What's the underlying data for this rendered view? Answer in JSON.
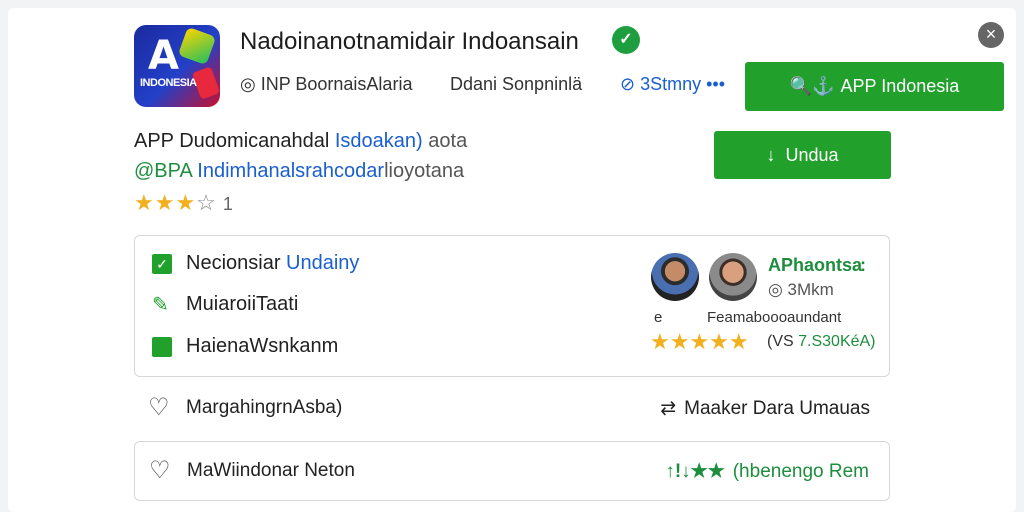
{
  "header": {
    "title": "Nadoinanotnamidair Indoansain",
    "close_icon": "×",
    "verified_icon": "✓",
    "app_icon": {
      "big": "A",
      "word": "INDONESIA"
    }
  },
  "meta": {
    "developer": "◎ INP BoornaisAlaria",
    "category": "Ddani Sonpninlä",
    "rank": "⊘ 3Stmny •••"
  },
  "buttons": {
    "primary_label": "APP Indonesia",
    "primary_icon": "🔍⚓",
    "secondary_label": "Undua",
    "secondary_icon": "↓"
  },
  "subtitle": {
    "line1_prefix": "APP Dudomicanahdal",
    "line1_link": "Isdoakan)",
    "line1_suffix": "aota",
    "line2_pub": "@BPA",
    "line2_link": "Indimhanalsrahcodar",
    "line2_suffix": "lioyotana"
  },
  "rating": {
    "full": "★",
    "half": "★",
    "empty": "☆",
    "stars_full": "★★★",
    "stars_empty": "☆",
    "count": "1"
  },
  "features": [
    {
      "icon": "check",
      "label": "Necionsiar",
      "link": "Undainy"
    },
    {
      "icon": "pencil",
      "label": "MuiaroiiTaati"
    },
    {
      "icon": "square",
      "label": "HaienaWsnkanm"
    }
  ],
  "review": {
    "name": "APhaontsa",
    "dots": ":",
    "sub": "◎ 3Mkm",
    "small_a": "e",
    "small_b": "Feamaboooaundant",
    "stars": "★★★★★",
    "score_a": "(VS",
    "score_b": "7.S30KéA)"
  },
  "rows": [
    {
      "icon": "♡",
      "label": "MargahingrnAsba)",
      "right_icon": "⇄",
      "right": "Maaker Dara Umauas"
    },
    {
      "icon": "♡",
      "label": "MaWiindonar Neton",
      "right_icon": "↑!↓★★",
      "right": "(hbenengo Rem"
    }
  ]
}
